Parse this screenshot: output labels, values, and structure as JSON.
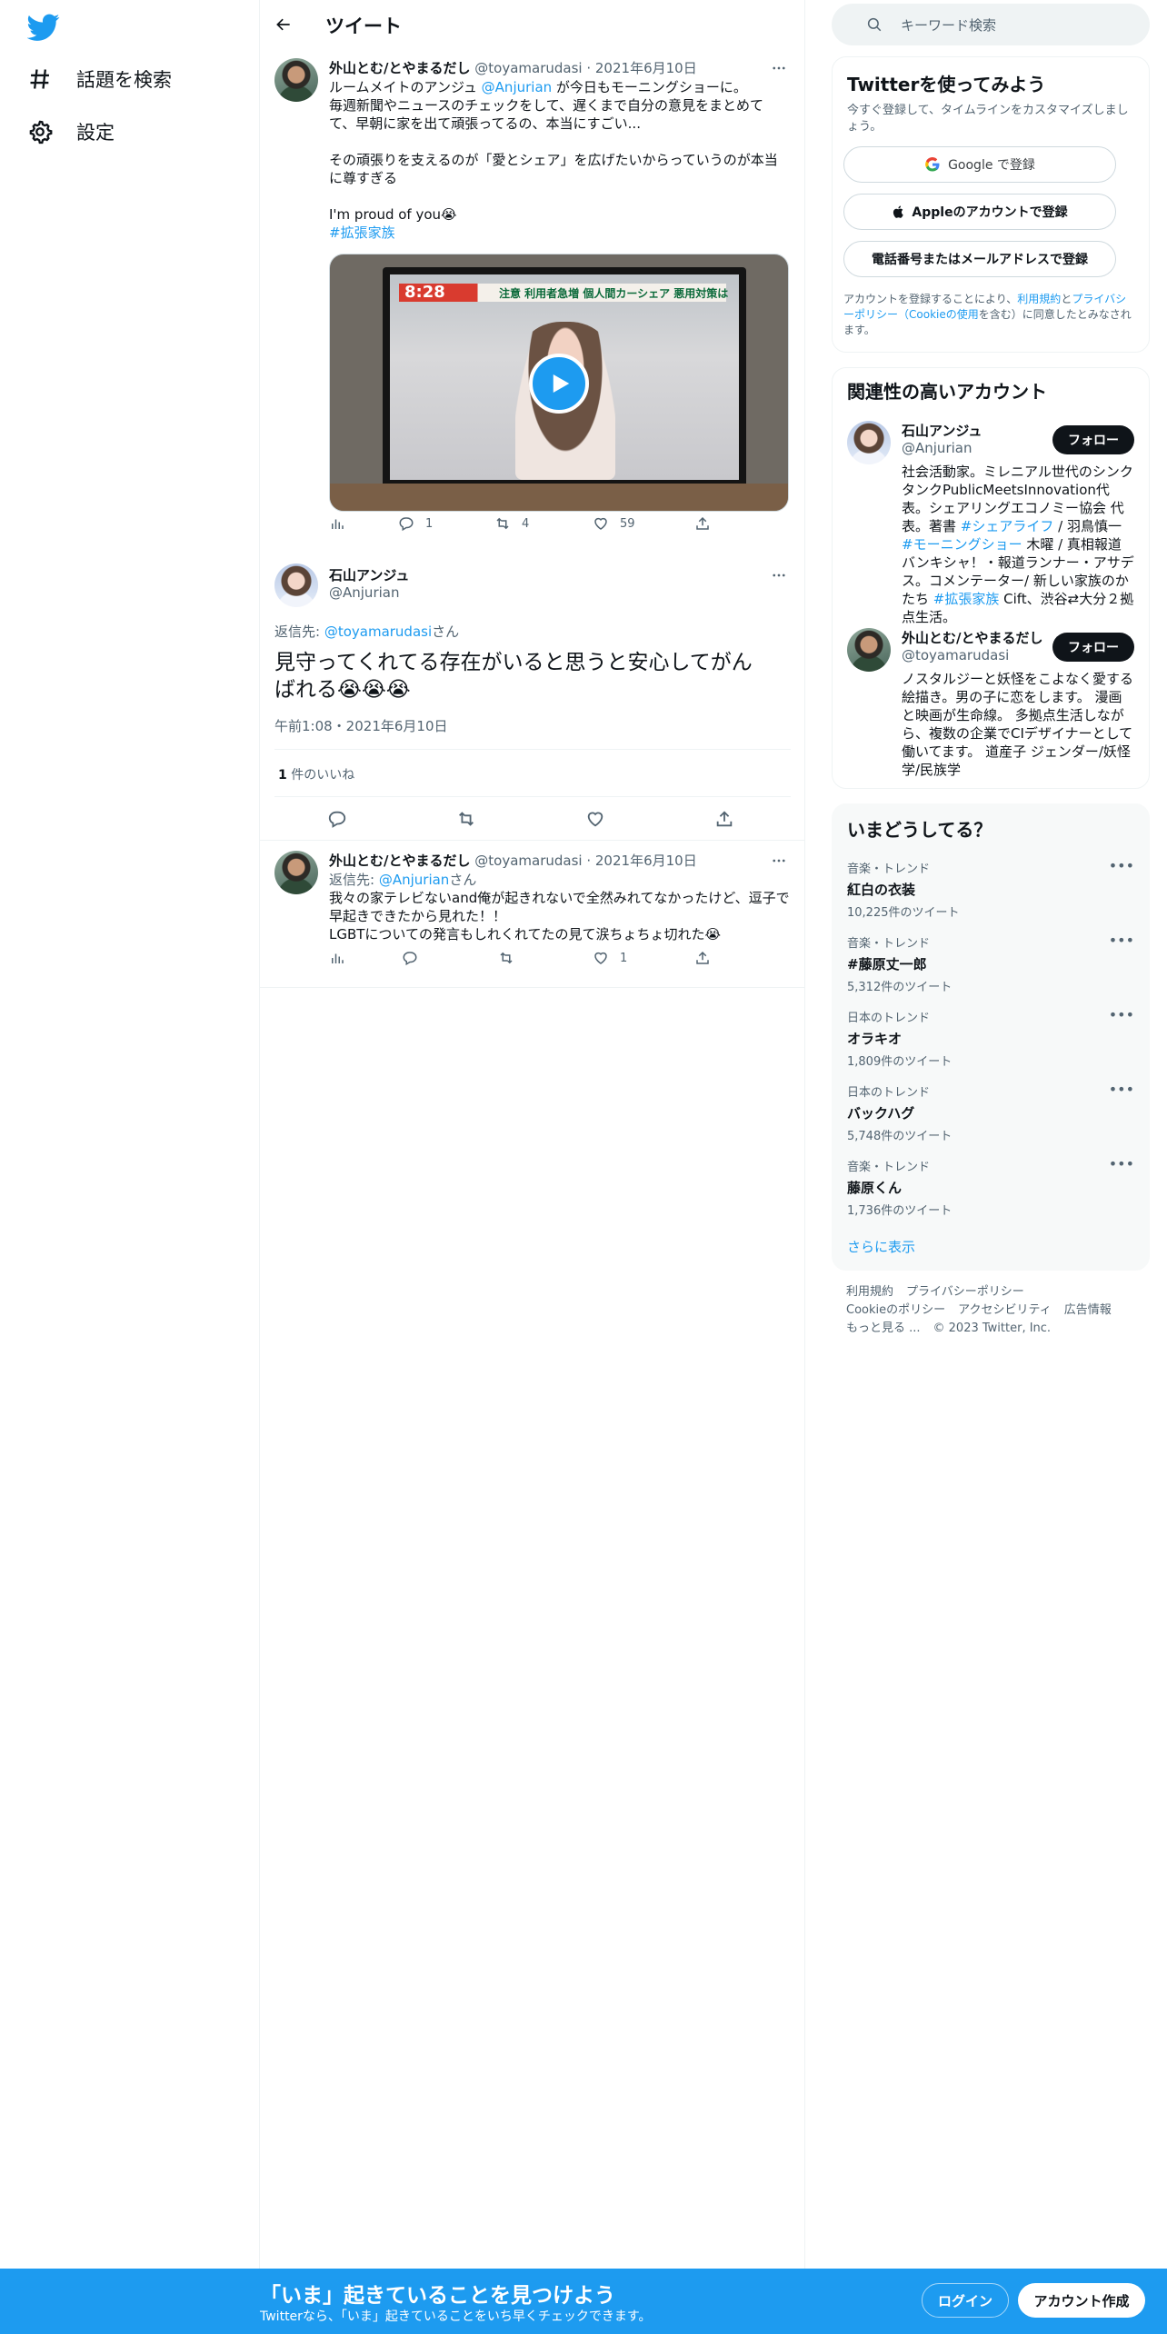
{
  "nav": {
    "explore_label": "話題を検索",
    "settings_label": "設定"
  },
  "header": {
    "title": "ツイート"
  },
  "tweet1": {
    "name": "外山とむ/とやまるだし",
    "handle": "@toyamarudasi",
    "date": "2021年6月10日",
    "text_pre": "ルームメイトのアンジュ ",
    "mention": "@Anjurian",
    "text_post": " が今日もモーニングショーに。\n毎週新聞やニュースのチェックをして、遅くまで自分の意見をまとめて\nて、早朝に家を出て頑張ってるの、本当にすごい...\n\nその頑張りを支えるのが「愛とシェア」を広げたいからっていうのが本当\nに尊すぎる\n\nI'm proud of you😭",
    "hashtag": "#拡張家族",
    "video": {
      "time_overlay": "8:28",
      "caption": "注意 利用者急増 個人間カーシェア 悪用対策は"
    },
    "replies": "1",
    "retweets": "4",
    "likes": "59"
  },
  "focal": {
    "name": "石山アンジュ",
    "handle": "@Anjurian",
    "reply_prefix": "返信先: ",
    "reply_to": "@toyamarudasi",
    "reply_suffix": "さん",
    "text": "見守ってくれてる存在がいると思うと安心してがん\nばれる😭😭😭",
    "time": "午前1:08・2021年6月10日",
    "like_count": "1",
    "like_label": " 件のいいね"
  },
  "tweet3": {
    "name": "外山とむ/とやまるだし",
    "handle": "@toyamarudasi",
    "date": "2021年6月10日",
    "reply_prefix": "返信先: ",
    "reply_to": "@Anjurian",
    "reply_suffix": "さん",
    "text": "我々の家テレビないand俺が起きれないで全然みれてなかったけど、逗子で\n早起きできたから見れた！！\nLGBTについての発言もしれくれてたの見て涙ちょちょ切れた😭",
    "likes": "1"
  },
  "search": {
    "placeholder": "キーワード検索"
  },
  "signup_card": {
    "title": "Twitterを使ってみよう",
    "subtitle": "今すぐ登録して、タイムラインをカスタマイズしましょう。",
    "google": "Google で登録",
    "apple": "Appleのアカウントで登録",
    "phone": "電話番号またはメールアドレスで登録",
    "terms_1": "アカウントを登録することにより、",
    "terms_link1": "利用規約",
    "terms_2": "と",
    "terms_link2": "プライバシーポリシー（Cookieの使用",
    "terms_3": "を含む）に同意したとみなされます。"
  },
  "related": {
    "title": "関連性の高いアカウント",
    "follow_label": "フォロー",
    "accounts": [
      {
        "name": "石山アンジュ",
        "handle": "@Anjurian",
        "bio_1": "社会活動家。ミレニアル世代のシンクタンクPublicMeetsInnovation代表。シェアリングエコノミー協会 代表。著書 ",
        "bio_tag1": "#シェアライフ",
        "bio_2": " / 羽鳥慎一 ",
        "bio_tag2": "#モーニングショー",
        "bio_3": " 木曜 / 真相報道バンキシャ！・報道ランナー・アサデス。コメンテーター/ 新しい家族のかたち ",
        "bio_tag3": "#拡張家族",
        "bio_4": " Cift、渋谷⇄大分２拠点生活。"
      },
      {
        "name": "外山とむ/とやまるだし",
        "handle": "@toyamarudasi",
        "bio_1": "ノスタルジーと妖怪をこよなく愛する絵描き。男の子に恋をします。 漫画と映画が生命線。 多拠点生活しながら、複数の企業でCIデザイナーとして働いてます。 道産子 ジェンダー/妖怪学/民族学"
      }
    ]
  },
  "trends": {
    "title": "いまどうしてる？",
    "items": [
      {
        "category": "音楽・トレンド",
        "name": "紅白の衣装",
        "count": "10,225件のツイート"
      },
      {
        "category": "音楽・トレンド",
        "name": "#藤原丈一郎",
        "count": "5,312件のツイート"
      },
      {
        "category": "日本のトレンド",
        "name": "オラキオ",
        "count": "1,809件のツイート"
      },
      {
        "category": "日本のトレンド",
        "name": "バックハグ",
        "count": "5,748件のツイート"
      },
      {
        "category": "音楽・トレンド",
        "name": "藤原くん",
        "count": "1,736件のツイート"
      }
    ],
    "show_more": "さらに表示"
  },
  "footer": {
    "links": [
      "利用規約",
      "プライバシーポリシー",
      "Cookieのポリシー",
      "アクセシビリティ",
      "広告情報",
      "もっと見る ..."
    ],
    "copyright": "© 2023 Twitter, Inc."
  },
  "bottom_bar": {
    "title": "「いま」起きていることを見つけよう",
    "subtitle": "Twitterなら、「いま」起きていることをいち早くチェックできます。",
    "login": "ログイン",
    "signup": "アカウント作成"
  },
  "colors": {
    "accent": "#1d9bf0",
    "text": "#0f1419",
    "secondary": "#536471"
  }
}
